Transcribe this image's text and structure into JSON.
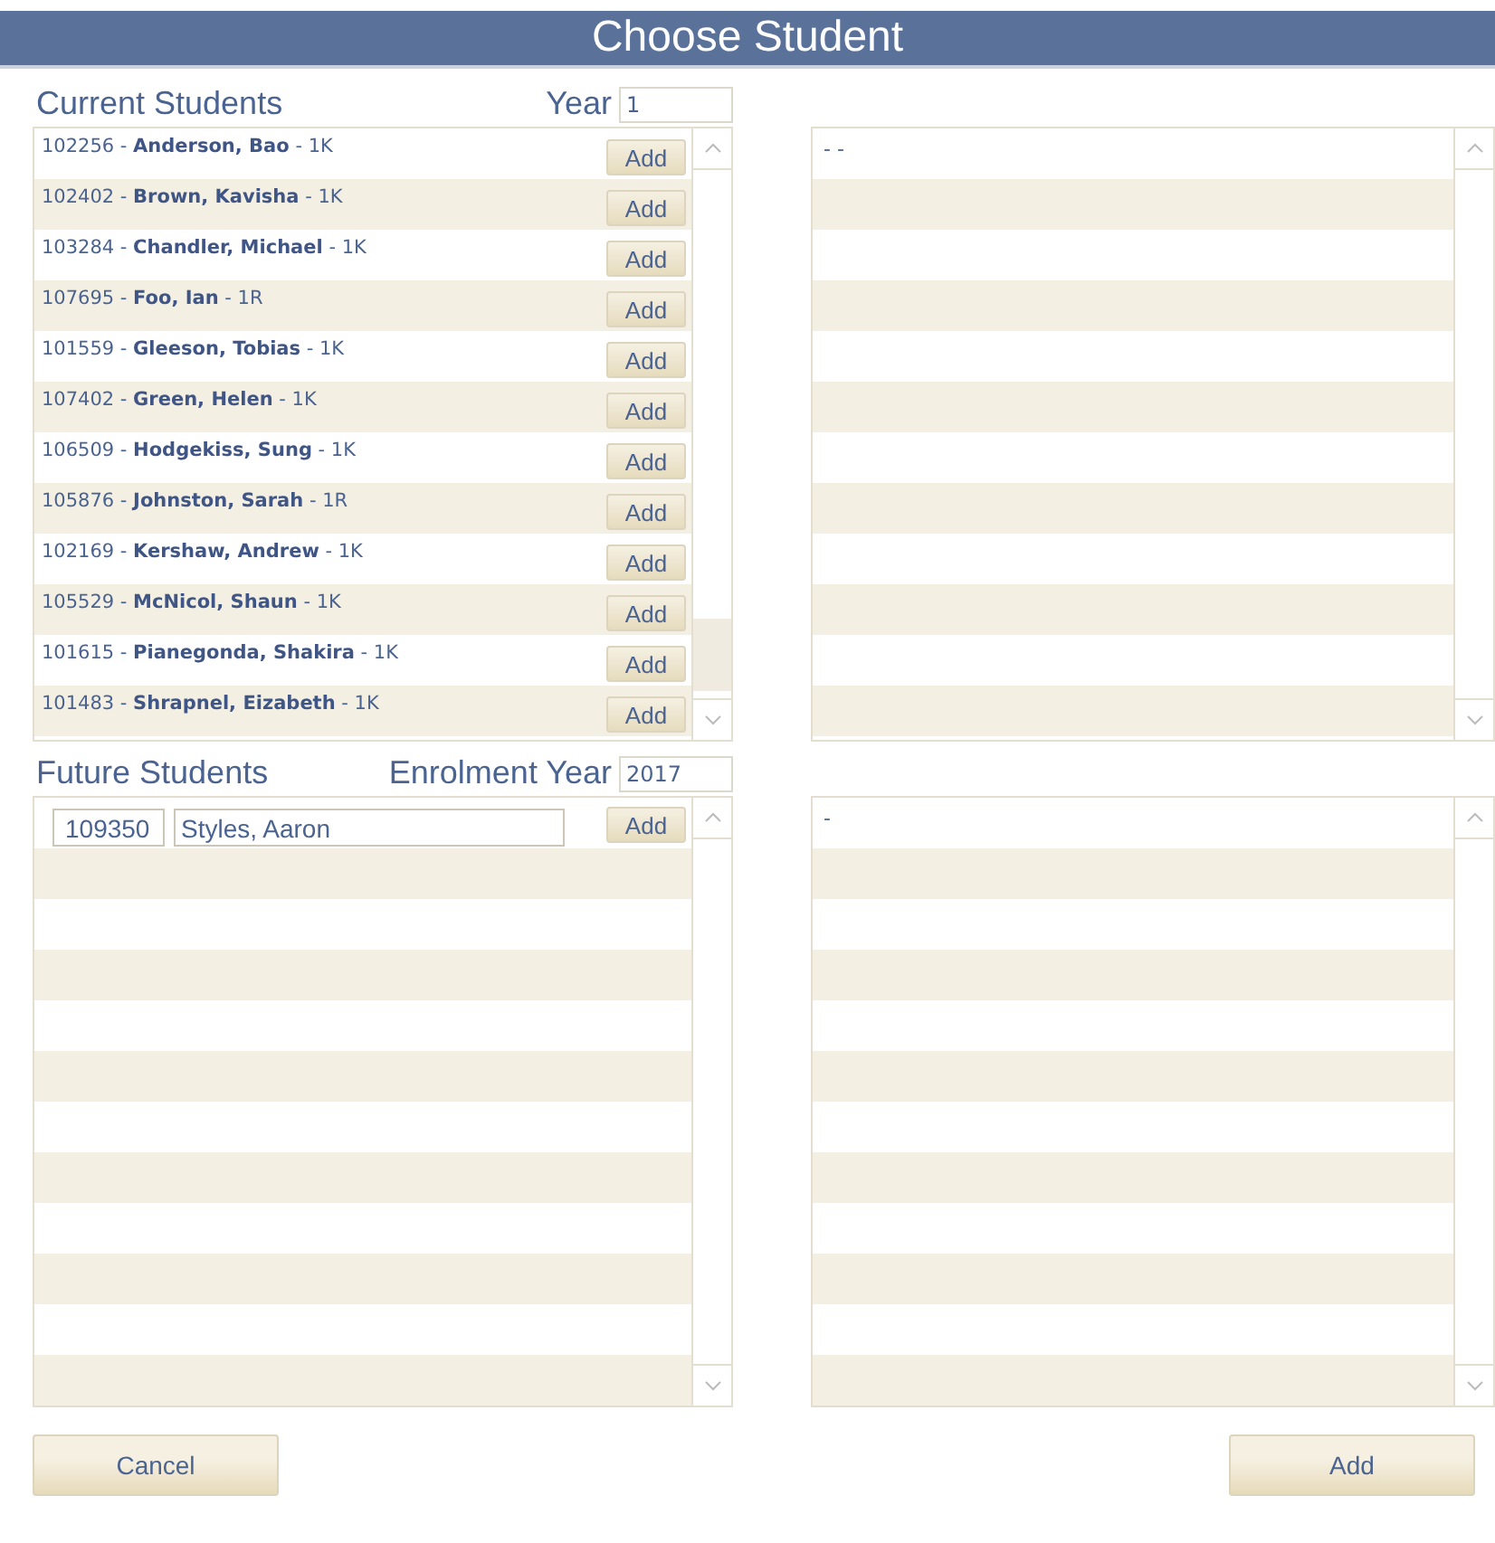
{
  "window": {
    "title": "Choose Student"
  },
  "current_students": {
    "heading": "Current Students",
    "year_label": "Year",
    "year_value": "1",
    "students": [
      {
        "entry": "102256 - **Anderson, Bao** - 1K",
        "button": "Add"
      },
      {
        "entry": "102402 - **Brown, Kavisha** - 1K",
        "button": "Add"
      },
      {
        "entry": "103284 - **Chandler, Michael** - 1K",
        "button": "Add"
      },
      {
        "entry": "107695 - **Foo, Ian** - 1R",
        "button": "Add"
      },
      {
        "entry": "101559 - **Gleeson, Tobias** - 1K",
        "button": "Add"
      },
      {
        "entry": "107402 - **Green, Helen** - 1K",
        "button": "Add"
      },
      {
        "entry": "106509 - **Hodgekiss, Sung** - 1K",
        "button": "Add"
      },
      {
        "entry": "105876 - **Johnston, Sarah** - 1R",
        "button": "Add"
      },
      {
        "entry": "102169 - **Kershaw, Andrew** - 1K",
        "button": "Add"
      },
      {
        "entry": "105529 - **McNicol, Shaun** - 1K",
        "button": "Add"
      },
      {
        "entry": "101615 - **Pianegonda, Shakira** - 1K",
        "button": "Add"
      },
      {
        "entry": "101483 - **Shrapnel, Eizabeth** - 1K",
        "button": "Add"
      }
    ]
  },
  "future_students": {
    "heading": "Future Students",
    "year_label": "Enrolment Year",
    "year_value": "2017",
    "rows": [
      {
        "id": "109350",
        "name": "Styles, Aaron",
        "button": "Add"
      }
    ]
  },
  "selected_current": {
    "rows": [
      "- -"
    ]
  },
  "selected_future": {
    "rows": [
      "-"
    ]
  },
  "buttons": {
    "cancel": "Cancel",
    "add": "Add"
  }
}
